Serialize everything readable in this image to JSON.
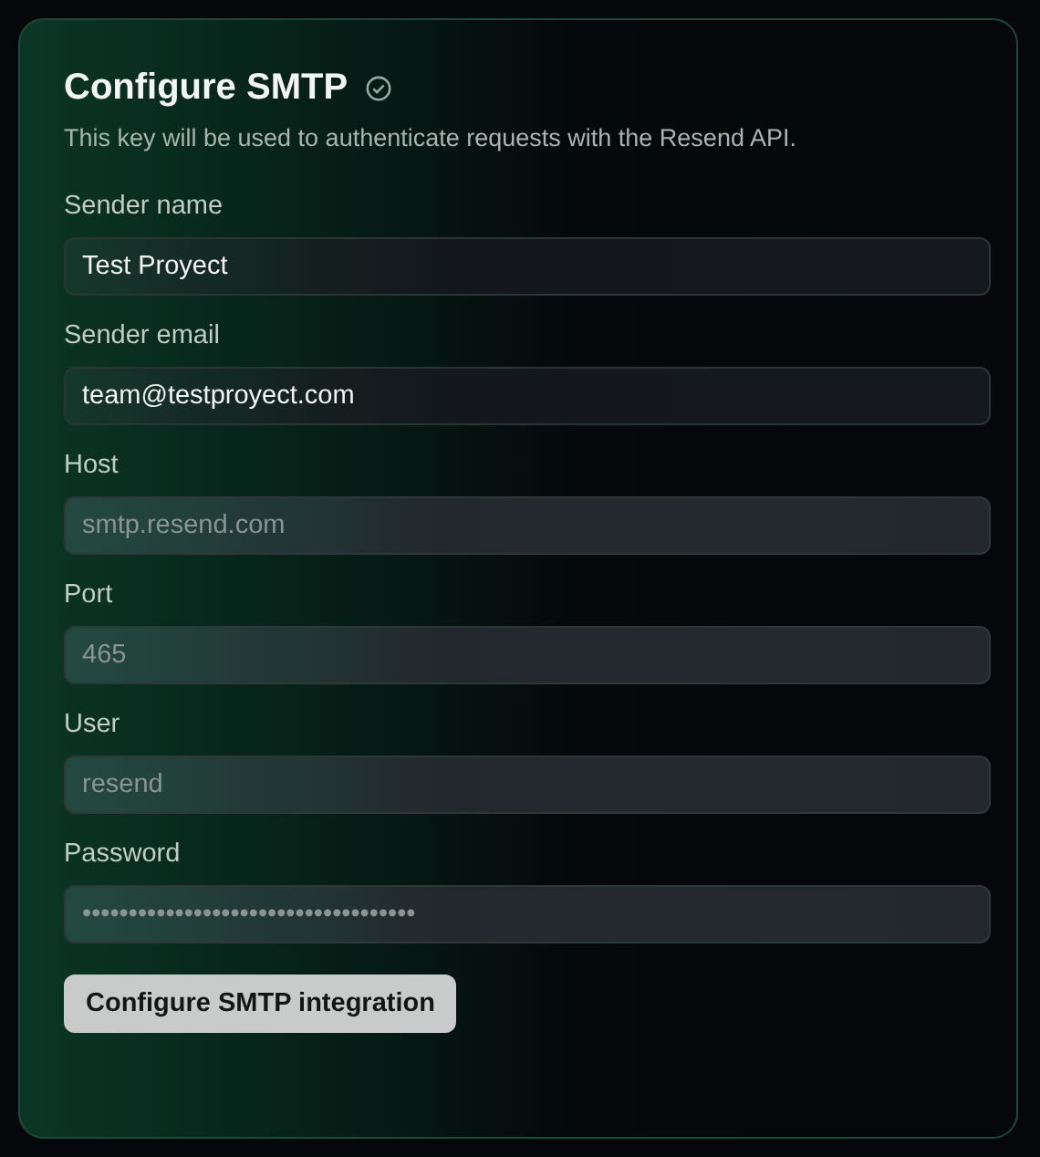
{
  "card": {
    "title": "Configure SMTP",
    "verified": true,
    "description": "This key will be used to authenticate requests with the Resend API.",
    "fields": [
      {
        "label": "Sender name",
        "value": "Test Proyect",
        "disabled": false
      },
      {
        "label": "Sender email",
        "value": "team@testproyect.com",
        "disabled": false
      },
      {
        "label": "Host",
        "value": "smtp.resend.com",
        "disabled": true
      },
      {
        "label": "Port",
        "value": "465",
        "disabled": true
      },
      {
        "label": "User",
        "value": "resend",
        "disabled": true
      },
      {
        "label": "Password",
        "value": "••••••••••••••••••••••••••••••••••••",
        "disabled": true
      }
    ],
    "button": "Configure SMTP integration"
  }
}
